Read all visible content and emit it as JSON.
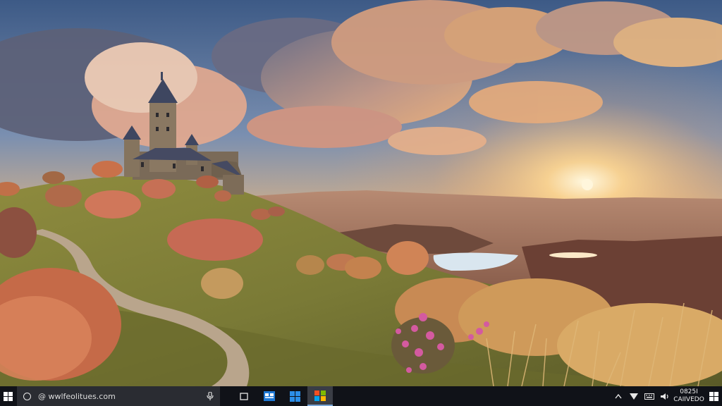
{
  "wallpaper": {
    "description_icon": "landscape-wallpaper",
    "colors": {
      "sky_top": "#3d5a86",
      "sky_horizon": "#f4c27a",
      "sun": "#fff4d6",
      "hill_grass": "#8a8a3c",
      "path": "#b9a58c",
      "shrub": "#c9714a",
      "castle_stone": "#7a6a58",
      "water": "#d9e6ef"
    }
  },
  "taskbar": {
    "start_icon": "windows-logo-icon",
    "search": {
      "text": "@ wwlfeolitues.com",
      "search_icon": "circle-search-icon",
      "mic_icon": "microphone-icon"
    },
    "task_icons": [
      {
        "name": "task-view-icon"
      },
      {
        "name": "app-blue-icon-1"
      },
      {
        "name": "app-blue-icon-2"
      },
      {
        "name": "store-icon",
        "active": true
      }
    ],
    "tray": {
      "chevron_icon": "chevron-up-icon",
      "network_icon": "network-icon",
      "keyboard_icon": "keyboard-icon",
      "volume_icon": "volume-icon",
      "clock_time": "0825I",
      "clock_date": "CAIIVEDO",
      "notification_icon": "notification-icon"
    },
    "colors": {
      "background": "#101218",
      "search_bg": "#2a2c32",
      "accent": "#7aa7d8"
    }
  }
}
